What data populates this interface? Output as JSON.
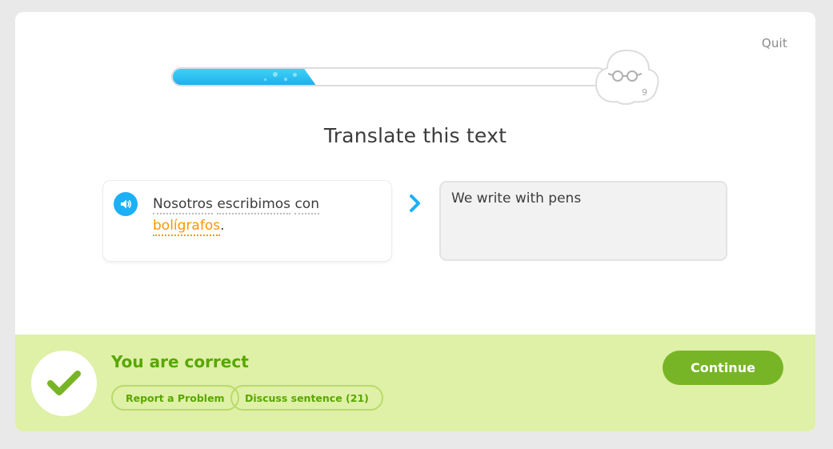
{
  "header": {
    "quit_label": "Quit"
  },
  "progress": {
    "fraction": 0.33,
    "counter": "9"
  },
  "challenge": {
    "title": "Translate this text",
    "speaker_icon": "speaker-icon",
    "prompt_words": [
      "Nosotros",
      "escribimos",
      "con",
      "bolígrafos",
      "."
    ],
    "answer": "We write with pens"
  },
  "feedback": {
    "title": "You are correct",
    "report_label": "Report a Problem",
    "discuss_label": "Discuss sentence (21)",
    "continue_label": "Continue"
  },
  "colors": {
    "accent_blue": "#1cb0f6",
    "new_word": "#ff9600",
    "success_green": "#58a700",
    "footer_bg": "#dff0a7",
    "continue_bg": "#78b526"
  }
}
